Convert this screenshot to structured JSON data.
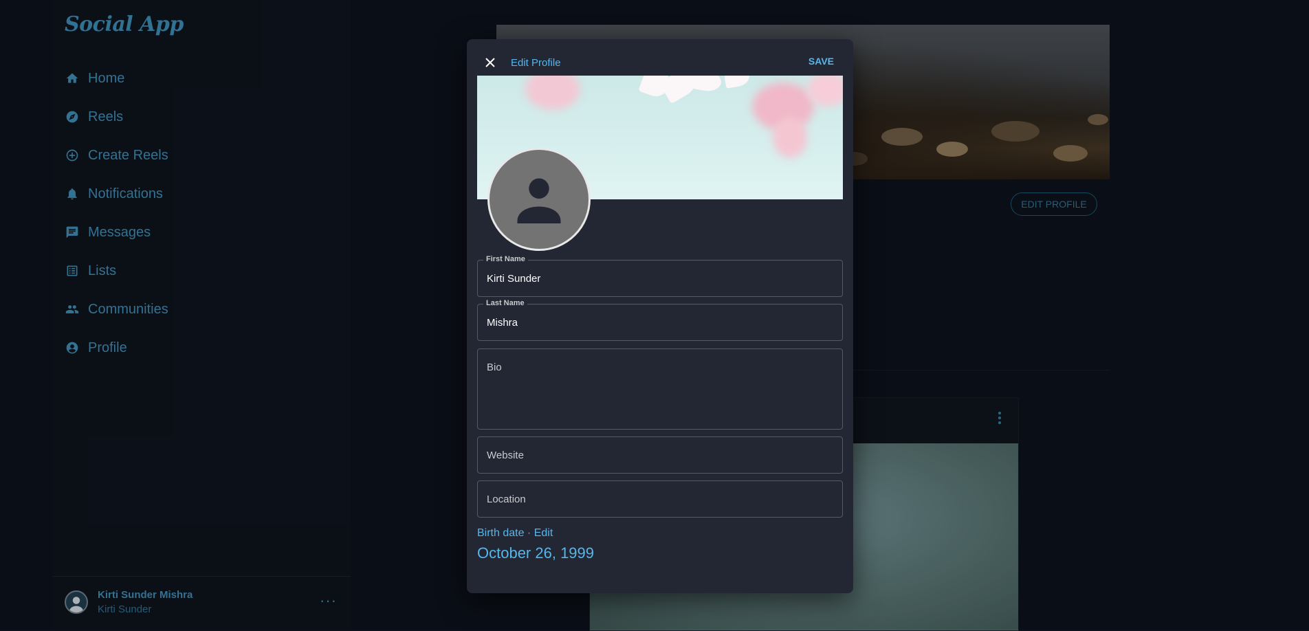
{
  "app": {
    "logo": "Social App"
  },
  "sidebar": {
    "items": [
      {
        "label": "Home",
        "icon": "home-icon"
      },
      {
        "label": "Reels",
        "icon": "compass-icon"
      },
      {
        "label": "Create Reels",
        "icon": "add-circle-icon"
      },
      {
        "label": "Notifications",
        "icon": "bell-icon"
      },
      {
        "label": "Messages",
        "icon": "message-icon"
      },
      {
        "label": "Lists",
        "icon": "list-icon"
      },
      {
        "label": "Communities",
        "icon": "people-icon"
      },
      {
        "label": "Profile",
        "icon": "account-circle-icon"
      }
    ],
    "user": {
      "name": "Kirti Sunder Mishra",
      "handle": "Kirti Sunder",
      "more": "···"
    }
  },
  "background": {
    "edit_profile_label": "EDIT PROFILE"
  },
  "modal": {
    "title": "Edit Profile",
    "save_label": "SAVE",
    "fields": {
      "first_name": {
        "label": "First Name",
        "value": "Kirti Sunder"
      },
      "last_name": {
        "label": "Last Name",
        "value": "Mishra"
      },
      "bio": {
        "placeholder": "Bio"
      },
      "website": {
        "placeholder": "Website"
      },
      "location": {
        "placeholder": "Location"
      }
    },
    "birth": {
      "label": "Birth date",
      "separator": " · ",
      "edit_label": "Edit",
      "date": "October 26, 1999"
    }
  },
  "colors": {
    "accent": "#56b7ec",
    "sidebar_text": "#3d86ad",
    "modal_bg": "#232633",
    "page_bg": "#0c111b"
  }
}
